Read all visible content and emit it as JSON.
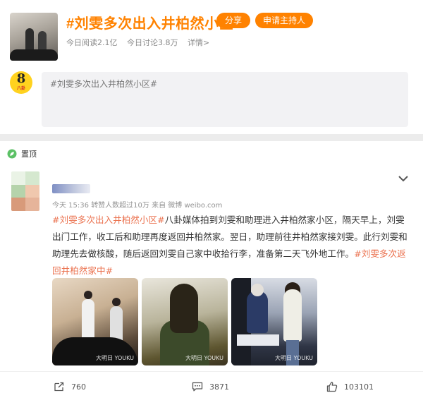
{
  "topic": {
    "title": "#刘雯多次出入井柏然小区#",
    "share_label": "分享",
    "host_label": "申请主持人",
    "reads": "今日阅读2.1亿",
    "discussions": "今日讨论3.8万",
    "details": "详情>",
    "cover_icon": "topic-cover-photo"
  },
  "composer": {
    "avatar_text": "8",
    "avatar_subtext": "八卦",
    "value": "#刘雯多次出入井柏然小区#"
  },
  "pinned": {
    "label": "置顶",
    "icon": "pin-icon"
  },
  "post": {
    "meta": {
      "time": "今天 15:36",
      "repost_note": "转赞人数超过10万",
      "source_prefix": "来自",
      "source": "微博 weibo.com"
    },
    "text": {
      "tag_start": "#刘雯多次出入井柏然小区#",
      "body": "八卦媒体拍到刘雯和助理进入井柏然家小区，隔天早上，刘雯出门工作，收工后和助理再度返回井柏然家。翌日，助理前往井柏然家接刘雯。此行刘雯和助理先去做核酸，随后返回刘雯自己家中收拾行李，准备第二天飞外地工作。",
      "tag_end": "#刘雯多次返回井柏然家中#"
    },
    "photos": [
      {
        "watermark": "大明日 YOUKU"
      },
      {
        "watermark": "大明日 YOUKU"
      },
      {
        "watermark": "大明日 YOUKU"
      }
    ],
    "actions": {
      "reposts": "760",
      "comments": "3871",
      "likes": "103101"
    }
  },
  "colors": {
    "accent": "#ff8200",
    "hashtag": "#eb7350",
    "muted": "#939393"
  }
}
